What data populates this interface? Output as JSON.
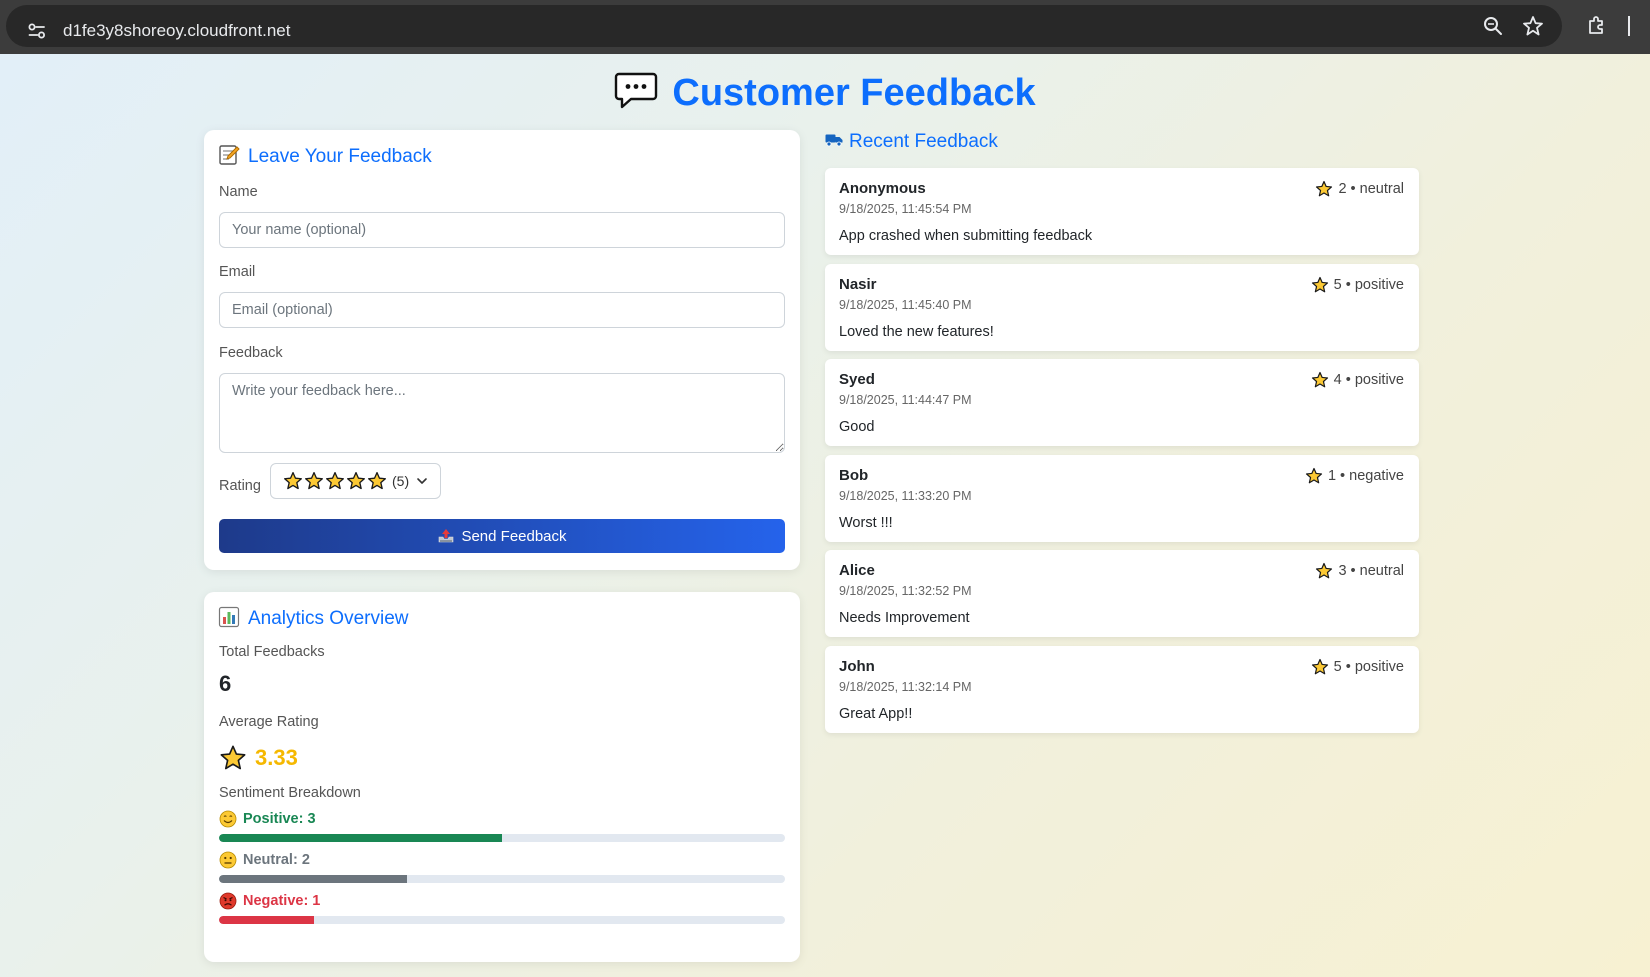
{
  "browser": {
    "url": "d1fe3y8shoreoy.cloudfront.net"
  },
  "page": {
    "title": "Customer Feedback"
  },
  "form": {
    "title": "Leave Your Feedback",
    "name_label": "Name",
    "name_placeholder": "Your name (optional)",
    "email_label": "Email",
    "email_placeholder": "Email (optional)",
    "feedback_label": "Feedback",
    "feedback_placeholder": "Write your feedback here...",
    "rating_label": "Rating",
    "rating_selected": "(5)",
    "rating_selected_value": 5,
    "submit_label": "Send Feedback"
  },
  "analytics": {
    "title": "Analytics Overview",
    "total_label": "Total Feedbacks",
    "total_value": "6",
    "average_label": "Average Rating",
    "average_value": "3.33",
    "sentiment_label": "Sentiment Breakdown",
    "sentiments": [
      {
        "label": "Positive: 3",
        "count": 3,
        "fraction": 0.5,
        "color": "#198754",
        "text_color": "#198754"
      },
      {
        "label": "Neutral: 2",
        "count": 2,
        "fraction": 0.333,
        "color": "#6c757d",
        "text_color": "#6c757d"
      },
      {
        "label": "Negative: 1",
        "count": 1,
        "fraction": 0.167,
        "color": "#dc3545",
        "text_color": "#dc3545"
      }
    ]
  },
  "recent": {
    "title": "Recent Feedback",
    "items": [
      {
        "name": "Anonymous",
        "rating": "2",
        "sentiment": "neutral",
        "time": "9/18/2025, 11:45:54 PM",
        "text": "App crashed when submitting feedback"
      },
      {
        "name": "Nasir",
        "rating": "5",
        "sentiment": "positive",
        "time": "9/18/2025, 11:45:40 PM",
        "text": "Loved the new features!"
      },
      {
        "name": "Syed",
        "rating": "4",
        "sentiment": "positive",
        "time": "9/18/2025, 11:44:47 PM",
        "text": "Good"
      },
      {
        "name": "Bob",
        "rating": "1",
        "sentiment": "negative",
        "time": "9/18/2025, 11:33:20 PM",
        "text": "Worst !!!"
      },
      {
        "name": "Alice",
        "rating": "3",
        "sentiment": "neutral",
        "time": "9/18/2025, 11:32:52 PM",
        "text": "Needs Improvement"
      },
      {
        "name": "John",
        "rating": "5",
        "sentiment": "positive",
        "time": "9/18/2025, 11:32:14 PM",
        "text": "Great App!!"
      }
    ]
  },
  "colors": {
    "accent": "#0d6efd",
    "star": "#f5b800",
    "button_start": "#1e3a8a",
    "button_end": "#2563eb"
  }
}
